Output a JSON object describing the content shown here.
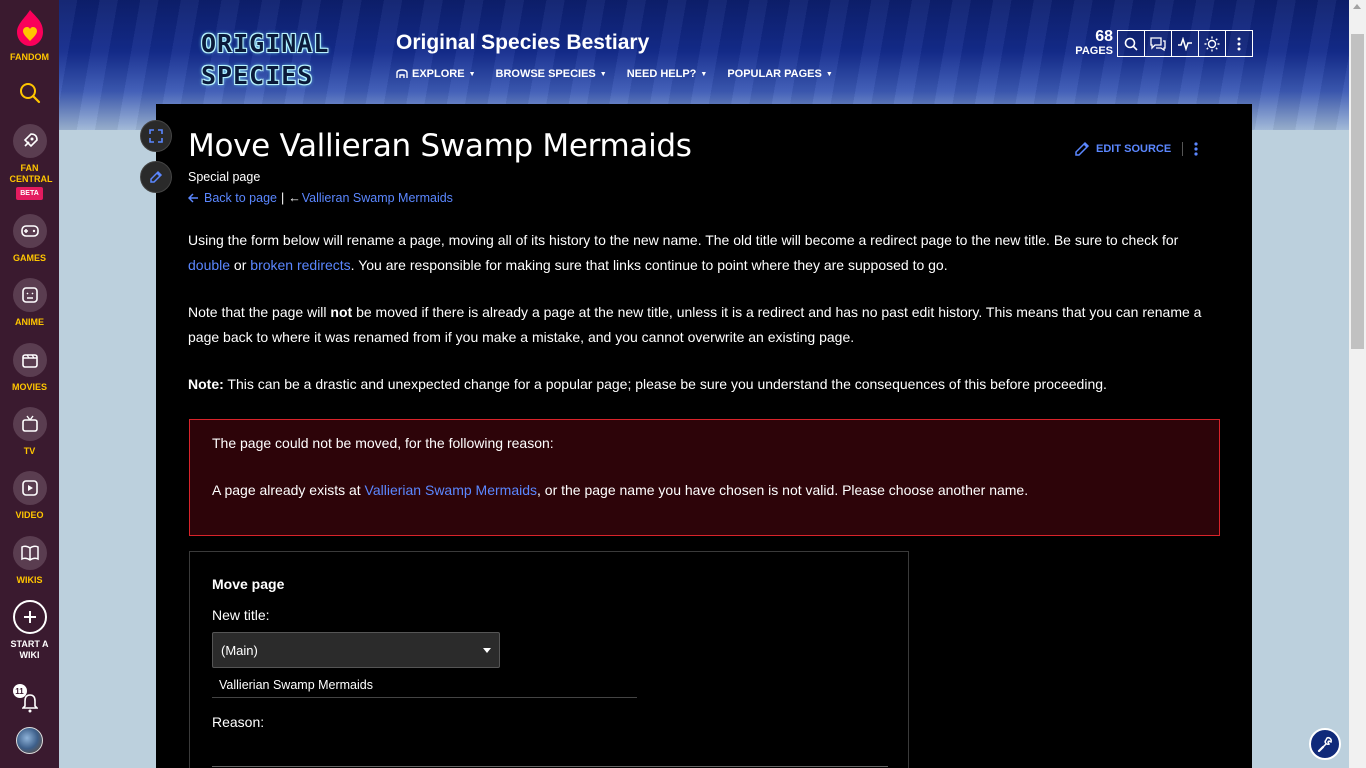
{
  "global_nav": {
    "fandom_label": "FANDOM",
    "fan_central_label": "FAN CENTRAL",
    "beta_label": "BETA",
    "games_label": "GAMES",
    "anime_label": "ANIME",
    "movies_label": "MOVIES",
    "tv_label": "TV",
    "video_label": "VIDEO",
    "wikis_label": "WIKIS",
    "start_wiki_label": "START A WIKI",
    "notifications_count": "11"
  },
  "header": {
    "logo_line1": "ORIGINAL",
    "logo_line2": "SPECIES",
    "wiki_title": "Original Species Bestiary",
    "nav": [
      "EXPLORE",
      "BROWSE SPECIES",
      "NEED HELP?",
      "POPULAR PAGES"
    ],
    "pages_count": "68",
    "pages_label": "PAGES"
  },
  "page": {
    "title": "Move Vallieran Swamp Mermaids",
    "subtitle": "Special page",
    "back_label": "Back to page",
    "separator": "|",
    "back_arrow": "←",
    "parent_link": "Vallieran Swamp Mermaids",
    "edit_source": "EDIT SOURCE"
  },
  "intro": {
    "p1_a": "Using the form below will rename a page, moving all of its history to the new name. The old title will become a redirect page to the new title. Be sure to check for ",
    "p1_link1": "double",
    "p1_b": " or ",
    "p1_link2": "broken redirects",
    "p1_c": ". You are responsible for making sure that links continue to point where they are supposed to go.",
    "p2_a": "Note that the page will ",
    "p2_bold": "not",
    "p2_b": " be moved if there is already a page at the new title, unless it is a redirect and has no past edit history. This means that you can rename a page back to where it was renamed from if you make a mistake, and you cannot overwrite an existing page.",
    "p3_bold": "Note:",
    "p3_text": " This can be a drastic and unexpected change for a popular page; please be sure you understand the consequences of this before proceeding."
  },
  "error": {
    "line1": "The page could not be moved, for the following reason:",
    "line2_a": "A page already exists at ",
    "line2_link": "Vallierian Swamp Mermaids",
    "line2_b": ", or the page name you have chosen is not valid. Please choose another name."
  },
  "form": {
    "legend": "Move page",
    "new_title_label": "New title:",
    "namespace_value": "(Main)",
    "title_value": "Vallierian Swamp Mermaids",
    "reason_label": "Reason:"
  },
  "colors": {
    "link": "#5b87ff",
    "accent": "#ffc500",
    "error_border": "#d8232a"
  }
}
